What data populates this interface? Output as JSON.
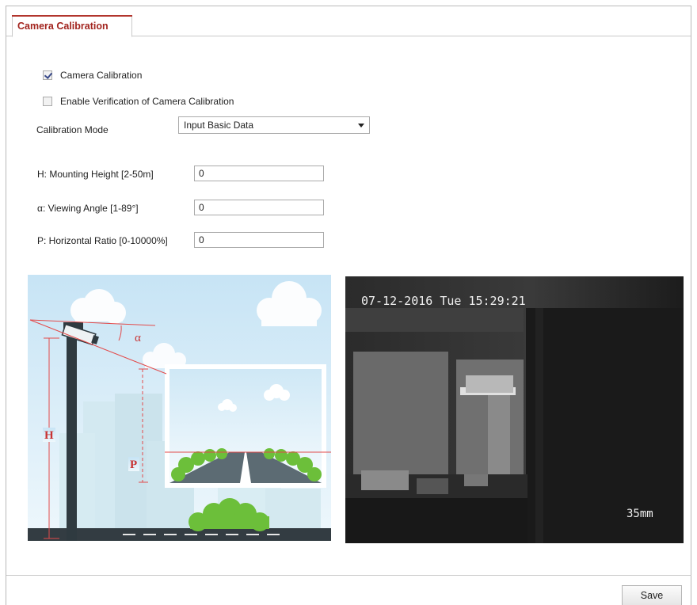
{
  "tab": {
    "label": "Camera Calibration"
  },
  "options": {
    "camera_calibration": {
      "label": "Camera Calibration",
      "checked": true
    },
    "verification": {
      "label": "Enable Verification of Camera Calibration",
      "checked": false
    }
  },
  "calibration_mode": {
    "label": "Calibration Mode",
    "value": "Input Basic Data"
  },
  "fields": {
    "height": {
      "label": "H: Mounting Height [2-50m]",
      "value": "0"
    },
    "angle": {
      "label": "α: Viewing Angle [1-89°]",
      "value": "0"
    },
    "ratio": {
      "label": "P: Horizontal Ratio [0-10000%]",
      "value": "0"
    }
  },
  "diagram": {
    "h_label": "H",
    "alpha_label": "α",
    "p_label": "P"
  },
  "camera_view": {
    "timestamp": "07-12-2016 Tue 15:29:21",
    "focal": "35mm"
  },
  "actions": {
    "save_label": "Save"
  }
}
